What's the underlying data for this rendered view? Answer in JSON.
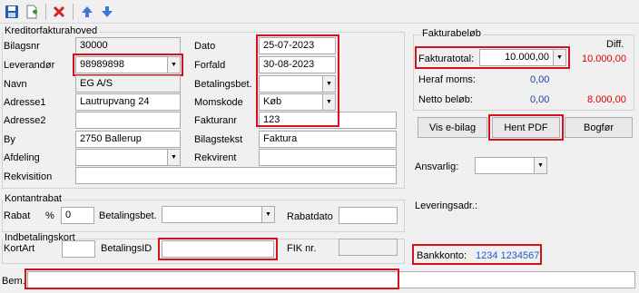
{
  "toolbar": {
    "icons": [
      "save-icon",
      "new-document-icon",
      "delete-icon",
      "arrow-up-icon",
      "arrow-down-icon"
    ]
  },
  "header": {
    "group_title": "Kreditorfakturahoved",
    "bilagsnr_label": "Bilagsnr",
    "bilagsnr_value": "30000",
    "leverandor_label": "Leverandør",
    "leverandor_value": "98989898",
    "navn_label": "Navn",
    "navn_value": "EG A/S",
    "adresse1_label": "Adresse1",
    "adresse1_value": "Lautrupvang 24",
    "adresse2_label": "Adresse2",
    "adresse2_value": "",
    "by_label": "By",
    "by_value": "2750 Ballerup",
    "afdeling_label": "Afdeling",
    "afdeling_value": "",
    "rekvisition_label": "Rekvisition",
    "rekvisition_value": "",
    "dato_label": "Dato",
    "dato_value": "25-07-2023",
    "forfald_label": "Forfald",
    "forfald_value": "30-08-2023",
    "betalingsbet_label": "Betalingsbet.",
    "betalingsbet_value": "",
    "momskode_label": "Momskode",
    "momskode_value": "Køb",
    "fakturanr_label": "Fakturanr",
    "fakturanr_value": "123",
    "bilagstekst_label": "Bilagstekst",
    "bilagstekst_value": "Faktura",
    "rekvirent_label": "Rekvirent",
    "rekvirent_value": ""
  },
  "fakturabelob": {
    "group_title": "Fakturabeløb",
    "diff_label": "Diff.",
    "fakturatotal_label": "Fakturatotal:",
    "fakturatotal_value": "10.000,00",
    "diff_value": "10.000,00",
    "heraf_moms_label": "Heraf moms:",
    "heraf_moms_value": "0,00",
    "netto_label": "Netto beløb:",
    "netto_value": "0,00",
    "netto_diff_value": "8.000,00"
  },
  "actions": {
    "vis_ebilag": "Vis e-bilag",
    "hent_pdf": "Hent PDF",
    "bogfor": "Bogfør"
  },
  "side": {
    "ansvarlig_label": "Ansvarlig:",
    "ansvarlig_value": "",
    "leveringsadr_label": "Leveringsadr.:",
    "bankkonto_label": "Bankkonto:",
    "bankkonto_value": "1234 1234567"
  },
  "kontantrabat": {
    "group_title": "Kontantrabat",
    "rabat_label": "Rabat",
    "percent_label": "%",
    "rabat_value": "0",
    "betalingsbet_label": "Betalingsbet.",
    "betalingsbet_value": "",
    "rabatdato_label": "Rabatdato",
    "rabatdato_value": ""
  },
  "indbetalingskort": {
    "group_title": "Indbetalingskort",
    "kortart_label": "KortArt",
    "kortart_value": "",
    "betalingsid_label": "BetalingsID",
    "betalingsid_value": "",
    "fiknr_label": "FIK nr.",
    "fiknr_value": ""
  },
  "bem": {
    "label": "Bem.",
    "value": ""
  },
  "colors": {
    "highlight": "#d8101a",
    "diff_red": "#e00000",
    "value_blue": "#1e3fa0",
    "link_blue": "#1a5bd8"
  }
}
